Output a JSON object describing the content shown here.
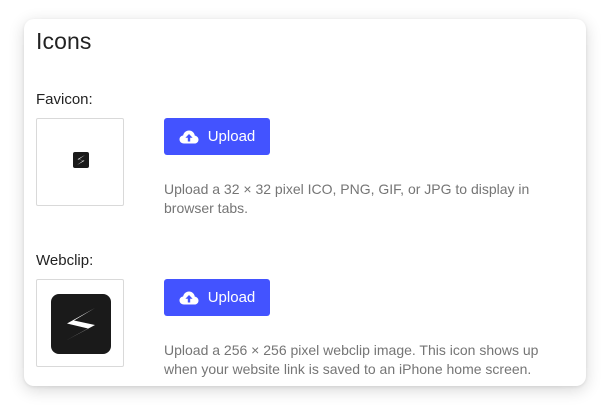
{
  "panel": {
    "title": "Icons"
  },
  "favicon": {
    "label": "Favicon:",
    "upload_label": "Upload",
    "help": "Upload a 32 × 32 pixel ICO, PNG, GIF, or JPG to display in browser tabs."
  },
  "webclip": {
    "label": "Webclip:",
    "upload_label": "Upload",
    "help": "Upload a 256 × 256 pixel webclip image. This icon shows up when your website link is saved to an iPhone home screen."
  },
  "icons": {
    "upload": "cloud-upload-icon",
    "favicon_preview": "bolt-logo-icon",
    "webclip_preview": "bolt-logo-icon"
  },
  "colors": {
    "accent": "#4353ff",
    "logo_bg": "#1a1a1a",
    "help_text": "#757575"
  }
}
